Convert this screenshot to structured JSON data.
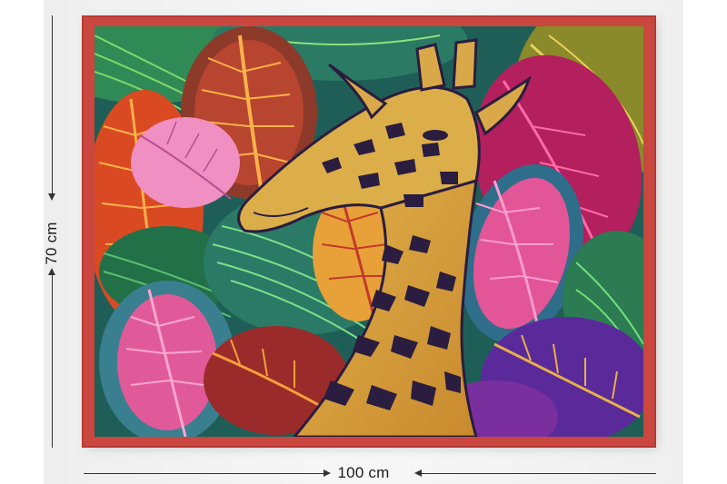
{
  "product": {
    "width_label": "100 cm",
    "height_label": "70 cm"
  },
  "colors": {
    "frame": "#c9473f",
    "dimension_line": "#333333",
    "background": "#eeeeee"
  }
}
